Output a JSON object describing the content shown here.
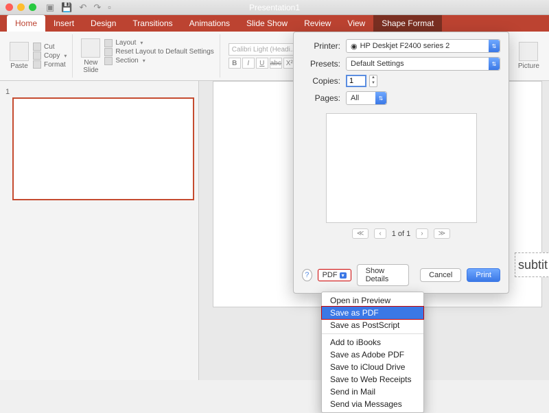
{
  "titlebar": {
    "title": "Presentation1"
  },
  "tabs": {
    "home": "Home",
    "insert": "Insert",
    "design": "Design",
    "transitions": "Transitions",
    "animations": "Animations",
    "slideshow": "Slide Show",
    "review": "Review",
    "view": "View",
    "shapeformat": "Shape Format"
  },
  "ribbon": {
    "paste": "Paste",
    "cut": "Cut",
    "copy": "Copy",
    "format": "Format",
    "newslide": "New\nSlide",
    "layout": "Layout",
    "reset": "Reset Layout to Default Settings",
    "section": "Section",
    "font_placeholder": "Calibri Light (Headi...",
    "btn_b": "B",
    "btn_i": "I",
    "btn_u": "U",
    "btn_abc": "abc",
    "btn_x2": "X²",
    "picture": "Picture"
  },
  "thumb": {
    "num": "1"
  },
  "stage": {
    "subtitle": "subtit"
  },
  "print": {
    "printer_label": "Printer:",
    "printer_value": "HP Deskjet F2400 series 2",
    "presets_label": "Presets:",
    "presets_value": "Default Settings",
    "copies_label": "Copies:",
    "copies_value": "1",
    "pages_label": "Pages:",
    "pages_value": "All",
    "page_indicator": "1 of 1",
    "nav_first": "≪",
    "nav_prev": "‹",
    "nav_next": "›",
    "nav_last": "≫",
    "help": "?",
    "pdf_label": "PDF",
    "showdetails": "Show Details",
    "cancel": "Cancel",
    "print_btn": "Print"
  },
  "pdfmenu": {
    "open_preview": "Open in Preview",
    "save_pdf": "Save as PDF",
    "save_ps": "Save as PostScript",
    "add_ibooks": "Add to iBooks",
    "save_adobe": "Save as Adobe PDF",
    "save_icloud": "Save to iCloud Drive",
    "save_web": "Save to Web Receipts",
    "send_mail": "Send in Mail",
    "send_msg": "Send via Messages"
  }
}
